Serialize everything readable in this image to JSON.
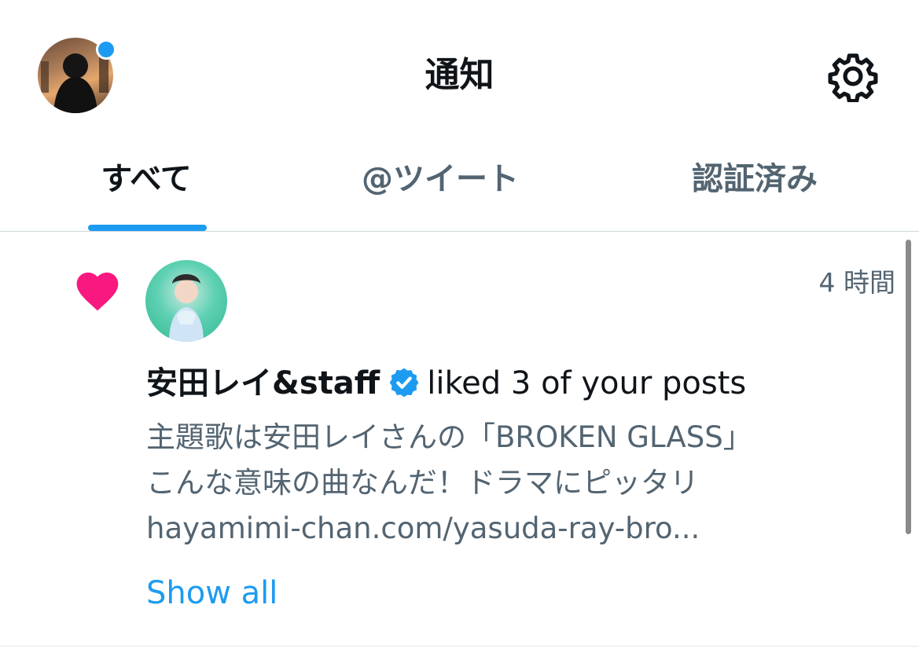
{
  "header": {
    "title": "通知",
    "settings_icon": "gear-icon",
    "avatar_badge_color": "#1d9bf0"
  },
  "tabs": [
    {
      "label": "すべて",
      "active": true
    },
    {
      "label": "@ツイート",
      "active": false
    },
    {
      "label": "認証済み",
      "active": false
    }
  ],
  "notification": {
    "type_icon": "heart-icon",
    "type_icon_color": "#f91880",
    "time": "4 時間",
    "user_name": "安田レイ&staff",
    "verified": true,
    "action_text": "liked 3 of your posts",
    "preview_lines": [
      "主題歌は安田レイさんの「BROKEN GLASS」",
      "こんな意味の曲なんだ！ドラマにピッタリ",
      "hayamimi-chan.com/yasuda-ray-bro..."
    ],
    "show_all_label": "Show all"
  },
  "colors": {
    "accent": "#1d9bf0",
    "like": "#f91880",
    "secondary_text": "#536471",
    "primary_text": "#0f1419"
  }
}
